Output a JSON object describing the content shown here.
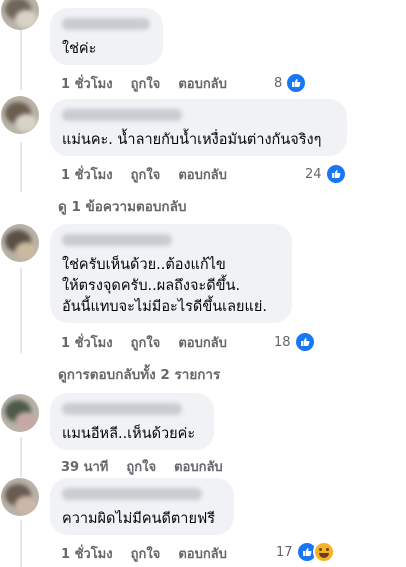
{
  "colors": {
    "bubble": "#f0f2f5",
    "meta": "#65676b",
    "like": "#1877f2",
    "haha": "#f7b125"
  },
  "comments": [
    {
      "text": "ใช่ค่ะ",
      "time": "1 ชั่วโมง",
      "like_label": "ถูกใจ",
      "reply_label": "ตอบกลับ",
      "reactions": "8",
      "reaction_icons": [
        "like-icon"
      ]
    },
    {
      "text": "แม่นคะ. น้ำลายกับน้ำเหงื่อมันต่างกันจริงๆ",
      "time": "1 ชั่วโมง",
      "like_label": "ถูกใจ",
      "reply_label": "ตอบกลับ",
      "reactions": "24",
      "reaction_icons": [
        "like-icon"
      ]
    },
    {
      "text": "ใช่ครับเห็นด้วย..ต้องแก้ไข\nให้ตรงจุดครับ..ผลถึงจะดีขึ้น.\nอันนี้แทบจะไม่มีอะไรดีขึ้นเลยแย่.",
      "time": "1 ชั่วโมง",
      "like_label": "ถูกใจ",
      "reply_label": "ตอบกลับ",
      "reactions": "18",
      "reaction_icons": [
        "like-icon"
      ]
    },
    {
      "text": "แมนอีหลี..เห็นด้วยค่ะ",
      "time": "39 นาที",
      "like_label": "ถูกใจ",
      "reply_label": "ตอบกลับ",
      "reactions": "",
      "reaction_icons": []
    },
    {
      "text": "ความผิดไม่มีคนดีตายฟรี",
      "time": "1 ชั่วโมง",
      "like_label": "ถูกใจ",
      "reply_label": "ตอบกลับ",
      "reactions": "17",
      "reaction_icons": [
        "like-icon",
        "haha-icon"
      ]
    }
  ],
  "view_replies_1": "ดู 1 ข้อความตอบกลับ",
  "view_replies_2": "ดูการตอบกลับทั้ง 2 รายการ"
}
